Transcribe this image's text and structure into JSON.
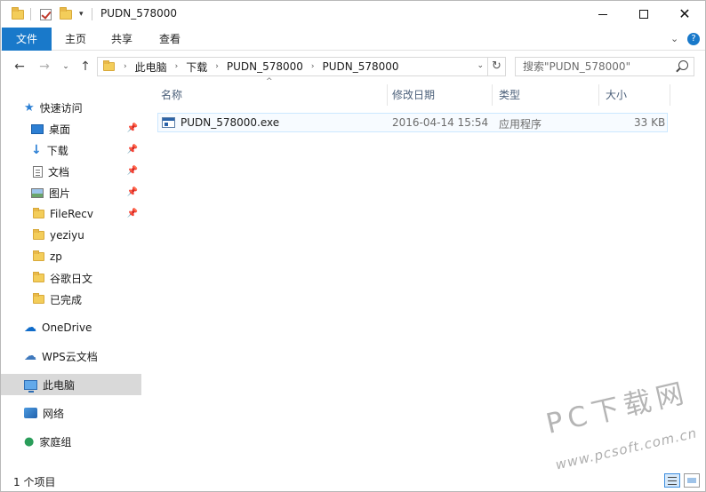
{
  "window": {
    "title": "PUDN_578000"
  },
  "ribbon": {
    "tabs": [
      "文件",
      "主页",
      "共享",
      "查看"
    ],
    "help": "?"
  },
  "address": {
    "crumbs": [
      "此电脑",
      "下载",
      "PUDN_578000",
      "PUDN_578000"
    ]
  },
  "search": {
    "placeholder": "搜索\"PUDN_578000\""
  },
  "nav": {
    "quick_access": "快速访问",
    "items": [
      "桌面",
      "下载",
      "文档",
      "图片",
      "FileRecv",
      "yeziyu",
      "zp",
      "谷歌日文",
      "已完成"
    ],
    "onedrive": "OneDrive",
    "wps": "WPS云文档",
    "this_pc": "此电脑",
    "network": "网络",
    "homegroup": "家庭组"
  },
  "columns": {
    "name": "名称",
    "modified": "修改日期",
    "type": "类型",
    "size": "大小"
  },
  "files": [
    {
      "name": "PUDN_578000.exe",
      "modified": "2016-04-14 15:54",
      "type": "应用程序",
      "size": "33 KB"
    }
  ],
  "status": {
    "count": "1 个项目"
  },
  "watermark": {
    "brand": "PC下载网",
    "url": "www.pcsoft.com.cn"
  },
  "colors": {
    "accent": "#1979ca",
    "selection": "#cce8ff"
  }
}
